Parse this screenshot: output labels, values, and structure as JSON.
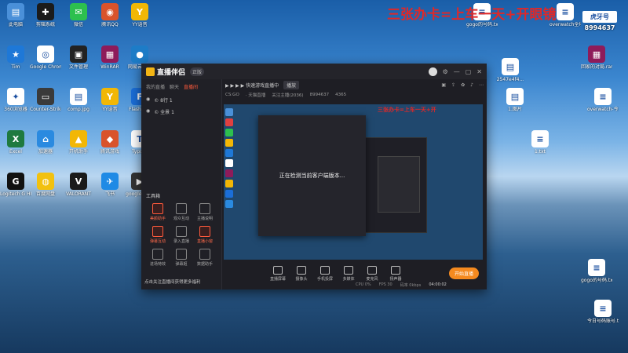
{
  "banner": "三张办卡=上车一天+开眼镜",
  "watermark": {
    "top": "虎牙号",
    "number": "8994637"
  },
  "desktop_left": [
    {
      "label": "此电脑",
      "color": "#4a90d9",
      "glyph": "▤"
    },
    {
      "label": "剪辑系统",
      "color": "#1b1b1b",
      "glyph": "✚"
    },
    {
      "label": "微信",
      "color": "#2dc04e",
      "glyph": "✉"
    },
    {
      "label": "腾讯QQ",
      "color": "#d9532b",
      "glyph": "◉"
    },
    {
      "label": "YY语音",
      "color": "#f2b705",
      "glyph": "Y"
    },
    {
      "label": "Tim",
      "color": "#1e78d7",
      "glyph": "★"
    },
    {
      "label": "Google Chrome",
      "color": "#ffffff",
      "glyph": "◎"
    },
    {
      "label": "文件管理",
      "color": "#222",
      "glyph": "▣"
    },
    {
      "label": "WinRAR",
      "color": "#8e1b5a",
      "glyph": "▦"
    },
    {
      "label": "网易云音乐",
      "color": "#1d7cc7",
      "glyph": "●"
    },
    {
      "label": "360浏览器",
      "color": "#ffffff",
      "glyph": "✦"
    },
    {
      "label": "Counter-Strike Global Offensive",
      "color": "#3a3a3a",
      "glyph": "▭"
    },
    {
      "label": "comp.jpg",
      "color": "#ffffff",
      "glyph": "▤"
    },
    {
      "label": "YY语音",
      "color": "#f2b705",
      "glyph": "Y"
    },
    {
      "label": "Flash中心",
      "color": "#1b6ed8",
      "glyph": "F"
    },
    {
      "label": "Excel",
      "color": "#1f7a3f",
      "glyph": "X"
    },
    {
      "label": "加速器",
      "color": "#2a8ae0",
      "glyph": "⌂"
    },
    {
      "label": "开机助手",
      "color": "#f2b705",
      "glyph": "▲"
    },
    {
      "label": "腾讯游戏",
      "color": "#d9532b",
      "glyph": "◆"
    },
    {
      "label": "Typora",
      "color": "#ffffff",
      "glyph": "T"
    },
    {
      "label": "Logitech G HUB",
      "color": "#111",
      "glyph": "G"
    },
    {
      "label": "百度网盘",
      "color": "#f2c10f",
      "glyph": "◍"
    },
    {
      "label": "VALORANT",
      "color": "#1a1a1a",
      "glyph": "V"
    },
    {
      "label": "飞书",
      "color": "#1f8ae5",
      "glyph": "✈"
    },
    {
      "label": "google.mp4",
      "color": "#333",
      "glyph": "▶"
    }
  ],
  "desktop_right": [
    {
      "label": "gogo的号码.txt",
      "color": "#ffffff",
      "glyph": "≡"
    },
    {
      "label": "overwatch全场景.txt",
      "color": "#ffffff",
      "glyph": "≡"
    },
    {
      "label": "2547e4f4...",
      "color": "#ffffff",
      "glyph": "▤"
    },
    {
      "label": "回家的对局.rar",
      "color": "#8e1b5a",
      "glyph": "▦"
    },
    {
      "label": "1.图片",
      "color": "#ffffff",
      "glyph": "▤"
    },
    {
      "label": "overwatch-今日任务",
      "color": "#ffffff",
      "glyph": "≡"
    },
    {
      "label": "1.txt",
      "color": "#ffffff",
      "glyph": "≡"
    },
    {
      "label": "gogo的号码.txt",
      "color": "#ffffff",
      "glyph": "≡"
    },
    {
      "label": "今日号码账号.txt",
      "color": "#ffffff",
      "glyph": "≡"
    }
  ],
  "app": {
    "title": "直播伴侣",
    "version": "正版",
    "scene_tabs": [
      "我的直播",
      "聊天",
      "直播间"
    ],
    "scenes": [
      "© 8行 1",
      "© 全景 1"
    ],
    "live_title": "▶ ▶ ▶ ▶ 快速游戏直播中",
    "live_btn": "播放",
    "sub_items": [
      "CS:GO",
      "· 天猫直播",
      "关注主播(2036)",
      "8994637",
      "4365"
    ],
    "tools_title": "工具箱",
    "tools": [
      {
        "label": "美颜助手",
        "red": true
      },
      {
        "label": "观众互动",
        "red": false
      },
      {
        "label": "主播说明",
        "red": false
      },
      {
        "label": "弹幕互动",
        "red": true
      },
      {
        "label": "录入直播",
        "red": false
      },
      {
        "label": "直播小窗",
        "red": true
      },
      {
        "label": "进场特效",
        "red": false
      },
      {
        "label": "弹幕姬",
        "red": false
      },
      {
        "label": "数据助手",
        "red": false
      }
    ],
    "hint": "点击关注直播间获得更多福利",
    "dialog_text": "正在检测当前客户端版本...",
    "preview_red": "三张办卡=上车一天+开",
    "controls": [
      "直播屏幕",
      "摄像头",
      "手机投屏",
      "多媒体",
      "麦克风",
      "扬声器"
    ],
    "go_live": "开始直播",
    "status": [
      "CPU 0%",
      "FPS 30",
      "码率 0kbps"
    ],
    "time": "04:00:02"
  }
}
